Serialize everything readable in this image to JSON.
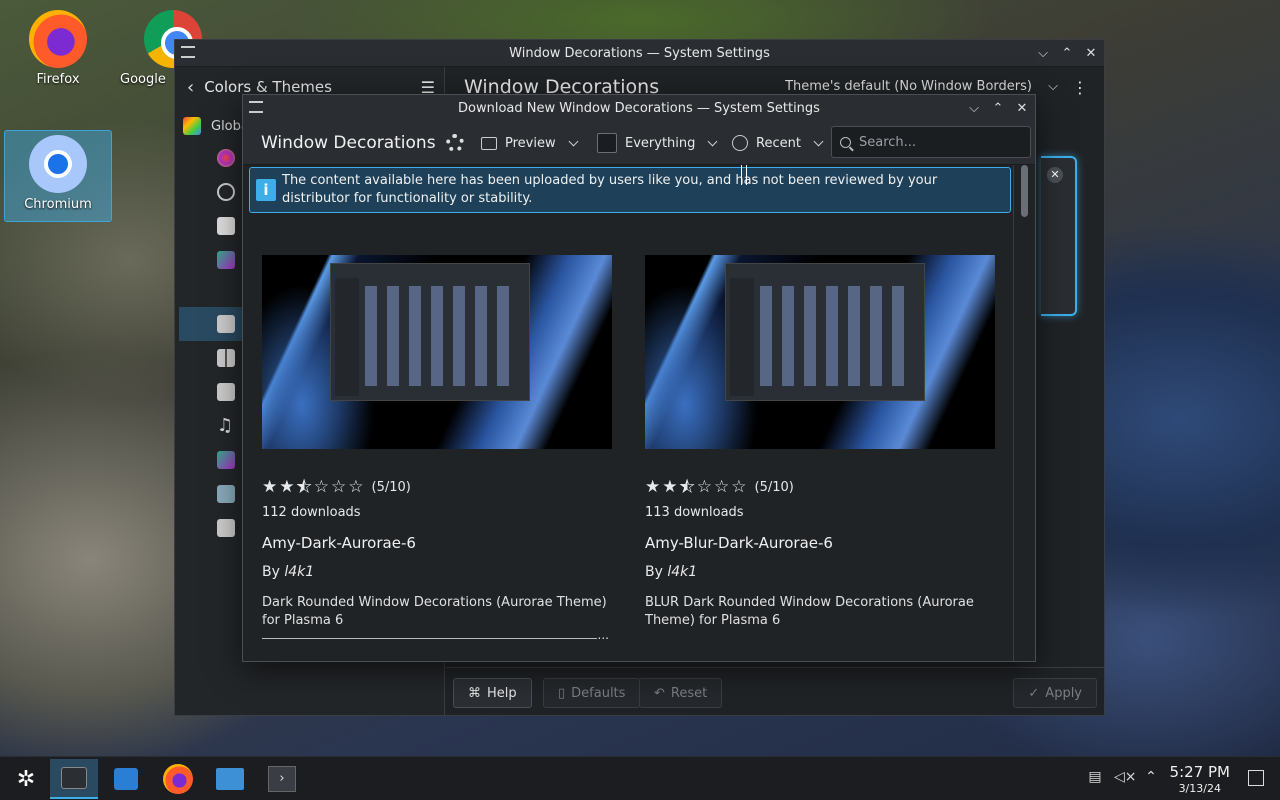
{
  "desktop": {
    "icons": [
      {
        "label": "Firefox"
      },
      {
        "label": "Google"
      },
      {
        "label": "Chromium"
      }
    ]
  },
  "back_window": {
    "title": "Window Decorations — System Settings",
    "sidebar_header": "Colors & Themes",
    "sidebar_first_item": "Globa",
    "main_title": "Window Decorations",
    "theme_select": "Theme's default (No Window Borders)",
    "buttons": {
      "help": "Help",
      "defaults": "Defaults",
      "reset": "Reset",
      "apply": "Apply"
    }
  },
  "dialog": {
    "title": "Download New Window Decorations — System Settings",
    "toolbar_title": "Window Decorations",
    "preview_label": "Preview",
    "filter_label": "Everything",
    "sort_label": "Recent",
    "search_placeholder": "Search...",
    "info_message": "The content available here has been uploaded by users like you, and has not been reviewed by your distributor for functionality or stability.",
    "items": [
      {
        "rating": "(5/10)",
        "rating_value": 5,
        "downloads": "112 downloads",
        "name": "Amy-Dark-Aurorae-6",
        "by": "By",
        "author": "l4k1",
        "description": "Dark Rounded Window Decorations (Aurorae Theme) for Plasma 6"
      },
      {
        "rating": "(5/10)",
        "rating_value": 5,
        "downloads": "113 downloads",
        "name": "Amy-Blur-Dark-Aurorae-6",
        "by": "By",
        "author": "l4k1",
        "description": "BLUR Dark Rounded Window Decorations (Aurorae Theme) for Plasma 6"
      }
    ]
  },
  "taskbar": {
    "time": "5:27 PM",
    "date": "3/13/24"
  },
  "colors": {
    "accent": "#3daee9",
    "window_bg": "#202326",
    "info_bg": "#1e4159"
  }
}
